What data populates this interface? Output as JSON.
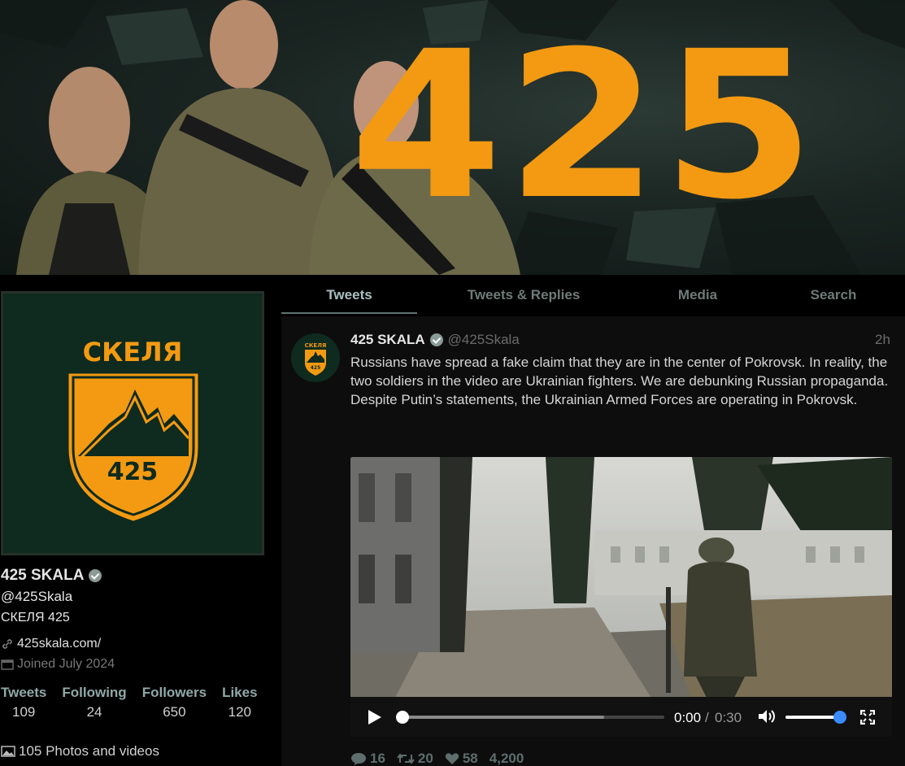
{
  "banner": {
    "number": "425"
  },
  "profile": {
    "logo_title": "СКЕЛЯ",
    "logo_number": "425",
    "name": "425 SKALA",
    "handle": "@425Skala",
    "bio": "СКЕЛЯ 425",
    "website": "425skala.com/",
    "joined": "Joined July 2024",
    "stats": [
      {
        "label": "Tweets",
        "value": "109"
      },
      {
        "label": "Following",
        "value": "24"
      },
      {
        "label": "Followers",
        "value": "650"
      },
      {
        "label": "Likes",
        "value": "120"
      }
    ],
    "photos_link": "105 Photos and videos"
  },
  "tabs": [
    {
      "label": "Tweets",
      "active": true
    },
    {
      "label": "Tweets & Replies",
      "active": false
    },
    {
      "label": "Media",
      "active": false
    },
    {
      "label": "Search",
      "active": false
    }
  ],
  "tweet": {
    "avatar_title": "СКЕЛЯ",
    "avatar_number": "425",
    "name": "425 SKALA",
    "handle": "@425Skala",
    "time": "2h",
    "text": "Russians have spread a fake claim that they are in the center of Pokrovsk. In reality, the two soldiers in the video are Ukrainian fighters. We are debunking Russian propaganda. Despite Putin’s statements, the Ukrainian Armed Forces are operating in Pokrovsk.",
    "video": {
      "current_time": "0:00",
      "separator": "/",
      "duration": "0:30",
      "progress": 0.0,
      "buffered": 0.77,
      "volume": 1.0
    },
    "replies": "16",
    "retweets": "20",
    "likes": "58",
    "views": "4,200"
  },
  "colors": {
    "accent_orange": "#f39a12",
    "logo_green": "#0f2a1e",
    "tab_active": "#a9c0bd",
    "muted": "#6b6b6b",
    "volume_knob": "#3b8bff"
  }
}
